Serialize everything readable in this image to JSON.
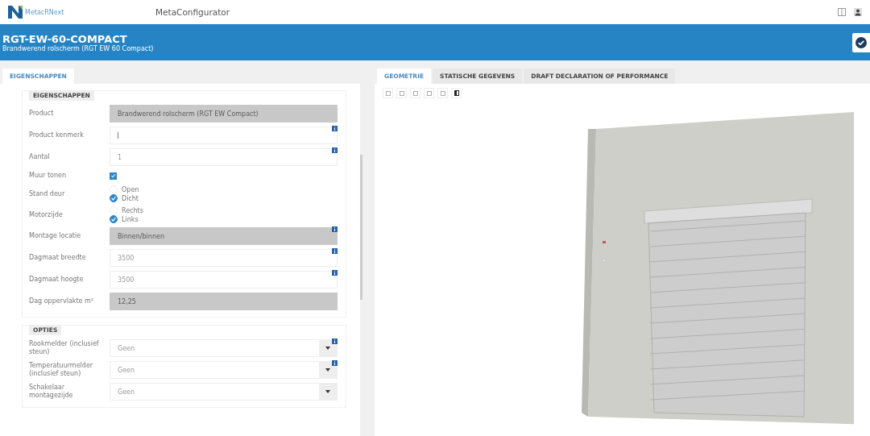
{
  "topbar": {
    "logo_text": "MetacRNext",
    "app_title": "MetaConfigurator"
  },
  "header": {
    "title": "RGT-EW-60-COMPACT",
    "subtitle": "Brandwerend rolscherm (RGT EW 60 Compact)"
  },
  "left_tabs": [
    {
      "label": "EIGENSCHAPPEN",
      "selected": true
    }
  ],
  "sections": [
    {
      "title": "EIGENSCHAPPEN",
      "fields": [
        {
          "kind": "readonly",
          "label": "Product",
          "value": "Brandwerend rolscherm (RGT EW Compact)",
          "info": false
        },
        {
          "kind": "text",
          "label": "Product kenmerk",
          "focused": true,
          "info": true
        },
        {
          "kind": "text",
          "label": "Aantal",
          "value": "1",
          "focused": false,
          "info": true
        },
        {
          "kind": "checkbox",
          "label": "Muur tonen",
          "checked": true
        },
        {
          "kind": "radio",
          "label": "Stand deur",
          "options": [
            {
              "label": "Open",
              "selected": false
            },
            {
              "label": "Dicht",
              "selected": true
            }
          ]
        },
        {
          "kind": "radio",
          "label": "Motorzijde",
          "options": [
            {
              "label": "Rechts",
              "selected": false
            },
            {
              "label": "Links",
              "selected": true
            }
          ]
        },
        {
          "kind": "readonly",
          "label": "Montage locatie",
          "value": "Binnen/binnen",
          "info": true
        },
        {
          "kind": "text",
          "label": "Dagmaat breedte",
          "value": "3500",
          "focused": false,
          "info": true
        },
        {
          "kind": "text",
          "label": "Dagmaat hoogte",
          "value": "3500",
          "focused": false,
          "info": true
        },
        {
          "kind": "readonly",
          "label": "Dag oppervlakte m²",
          "value": "12,25",
          "info": false
        }
      ]
    },
    {
      "title": "OPTIES",
      "fields": [
        {
          "kind": "select",
          "label": "Rookmelder (inclusief steun)",
          "value": "Geen",
          "info": true
        },
        {
          "kind": "select",
          "label": "Temperatuurmelder (inclusief steun)",
          "value": "Geen",
          "info": true
        },
        {
          "kind": "select",
          "label": "Schakelaar montagezijde",
          "value": "Geen",
          "info": false
        }
      ]
    }
  ],
  "right_tabs": [
    {
      "label": "GEOMETRIE",
      "selected": true
    },
    {
      "label": "STATISCHE GEGEVENS",
      "selected": false
    },
    {
      "label": "DRAFT DECLARATION OF PERFORMANCE",
      "selected": false
    }
  ]
}
